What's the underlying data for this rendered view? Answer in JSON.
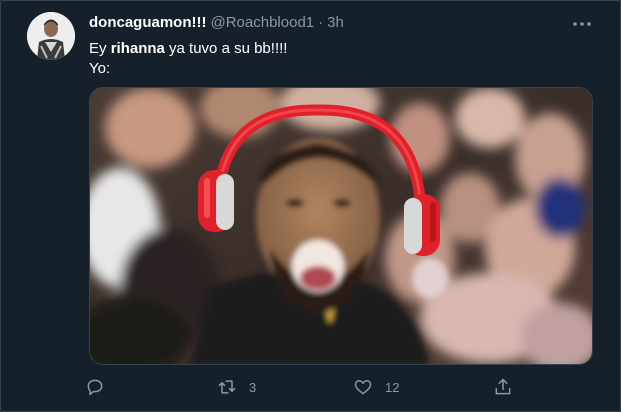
{
  "tweet": {
    "display_name": "doncaguamon!!!",
    "handle": "@Roachblood1",
    "separator": "·",
    "time": "3h",
    "text_line1_pre": "Ey ",
    "text_line1_bold": "rihanna",
    "text_line1_post": " ya tuvo  a su bb!!!!",
    "text_line2": "Yo:",
    "reply_count": "",
    "retweet_count": "3",
    "like_count": "12"
  },
  "icons": {
    "more": "more-horizontal-icon",
    "reply": "reply-icon",
    "retweet": "retweet-icon",
    "like": "heart-icon",
    "share": "share-icon"
  },
  "colors": {
    "background": "#15202b",
    "secondary_text": "#8b98a5",
    "border": "#38444d",
    "headphones": "#e0202a"
  }
}
